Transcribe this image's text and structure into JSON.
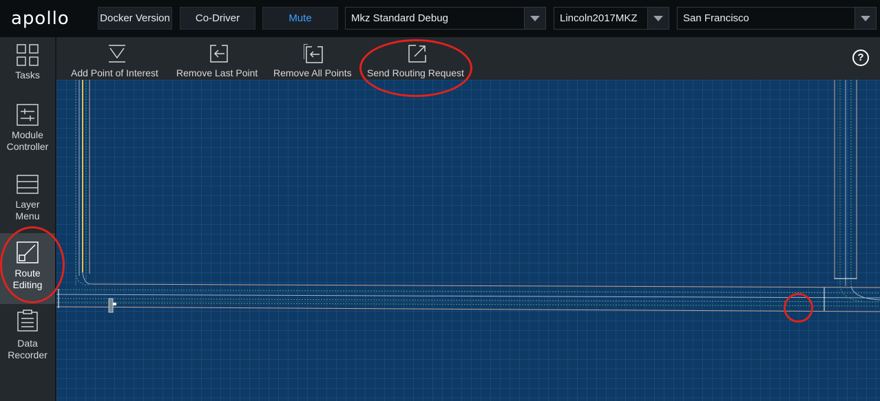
{
  "header": {
    "logo": "apollo",
    "buttons": {
      "docker_version": "Docker Version",
      "co_driver": "Co-Driver",
      "mute": "Mute"
    },
    "selects": {
      "mode": "Mkz Standard Debug",
      "vehicle": "Lincoln2017MKZ",
      "map": "San Francisco"
    }
  },
  "sidebar": {
    "items": [
      {
        "label_lines": [
          "Tasks"
        ],
        "icon": "tasks-grid-icon",
        "active": false
      },
      {
        "label_lines": [
          "Module",
          "Controller"
        ],
        "icon": "module-controller-icon",
        "active": false
      },
      {
        "label_lines": [
          "Layer",
          "Menu"
        ],
        "icon": "layer-menu-icon",
        "active": false
      },
      {
        "label_lines": [
          "Route",
          "Editing"
        ],
        "icon": "route-editing-icon",
        "active": true
      },
      {
        "label_lines": [
          "Data",
          "Recorder"
        ],
        "icon": "data-recorder-icon",
        "active": false
      }
    ],
    "labels": {
      "tasks": "Tasks",
      "module_1": "Module",
      "module_2": "Controller",
      "layer_1": "Layer",
      "layer_2": "Menu",
      "route_1": "Route",
      "route_2": "Editing",
      "data_1": "Data",
      "data_2": "Recorder"
    }
  },
  "toolbar": {
    "add_poi": "Add Point of Interest",
    "remove_last": "Remove Last Point",
    "remove_all": "Remove All Points",
    "send_routing": "Send Routing Request",
    "help_icon": "help-circle-icon",
    "help_glyph": "?"
  },
  "colors": {
    "map_background": "#0e3a66",
    "accent_blue": "#3ea1ff",
    "annotation_red": "#e0231c",
    "lane_yellow": "#e8c23a"
  }
}
